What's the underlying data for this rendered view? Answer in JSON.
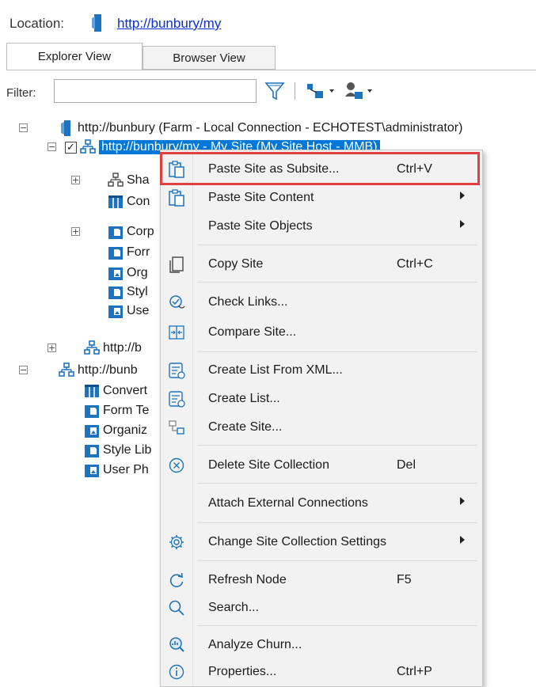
{
  "location": {
    "label": "Location:",
    "url": "http://bunbury/my"
  },
  "tabs": {
    "explorer": "Explorer View",
    "browser": "Browser View"
  },
  "filter": {
    "label": "Filter:",
    "value": ""
  },
  "tree": {
    "root": "http://bunbury (Farm - Local Connection - ECHOTEST\\administrator)",
    "selected": "http://bunbury/my - My Site (My Site Host - MMB)",
    "children": [
      "Sha",
      "Con",
      "Corp",
      "Forr",
      "Org",
      "Styl",
      "Use"
    ],
    "sibling": "http://b",
    "site2": "http://bunb",
    "site2_children": [
      "Convert",
      "Form Te",
      "Organiz",
      "Style Lib",
      "User Ph"
    ]
  },
  "menu": {
    "items": [
      {
        "label": "Paste Site as Subsite...",
        "shortcut": "Ctrl+V",
        "submenu": false,
        "icon": "paste-icon"
      },
      {
        "label": "Paste Site Content",
        "shortcut": "",
        "submenu": true,
        "icon": "paste-icon"
      },
      {
        "label": "Paste Site Objects",
        "shortcut": "",
        "submenu": true,
        "icon": ""
      },
      {
        "label": "Copy Site",
        "shortcut": "Ctrl+C",
        "submenu": false,
        "icon": "copy-icon"
      },
      {
        "label": "Check Links...",
        "shortcut": "",
        "submenu": false,
        "icon": "check-links-icon"
      },
      {
        "label": "Compare Site...",
        "shortcut": "",
        "submenu": false,
        "icon": "compare-icon"
      },
      {
        "label": "Create List From XML...",
        "shortcut": "",
        "submenu": false,
        "icon": "create-list-xml-icon"
      },
      {
        "label": "Create List...",
        "shortcut": "",
        "submenu": false,
        "icon": "create-list-icon"
      },
      {
        "label": "Create Site...",
        "shortcut": "",
        "submenu": false,
        "icon": "create-site-icon"
      },
      {
        "label": "Delete Site Collection",
        "shortcut": "Del",
        "submenu": false,
        "icon": "delete-icon"
      },
      {
        "label": "Attach External Connections",
        "shortcut": "",
        "submenu": true,
        "icon": ""
      },
      {
        "label": "Change Site Collection Settings",
        "shortcut": "",
        "submenu": true,
        "icon": "gear-icon"
      },
      {
        "label": "Refresh Node",
        "shortcut": "F5",
        "submenu": false,
        "icon": "refresh-icon"
      },
      {
        "label": "Search...",
        "shortcut": "",
        "submenu": false,
        "icon": "search-icon"
      },
      {
        "label": "Analyze Churn...",
        "shortcut": "",
        "submenu": false,
        "icon": "analyze-icon"
      },
      {
        "label": "Properties...",
        "shortcut": "Ctrl+P",
        "submenu": false,
        "icon": "info-icon"
      }
    ]
  },
  "colors": {
    "selection": "#0078d7",
    "highlight_box": "#e0403f",
    "link": "#0b2fd6",
    "icon_blue": "#1e73be"
  }
}
